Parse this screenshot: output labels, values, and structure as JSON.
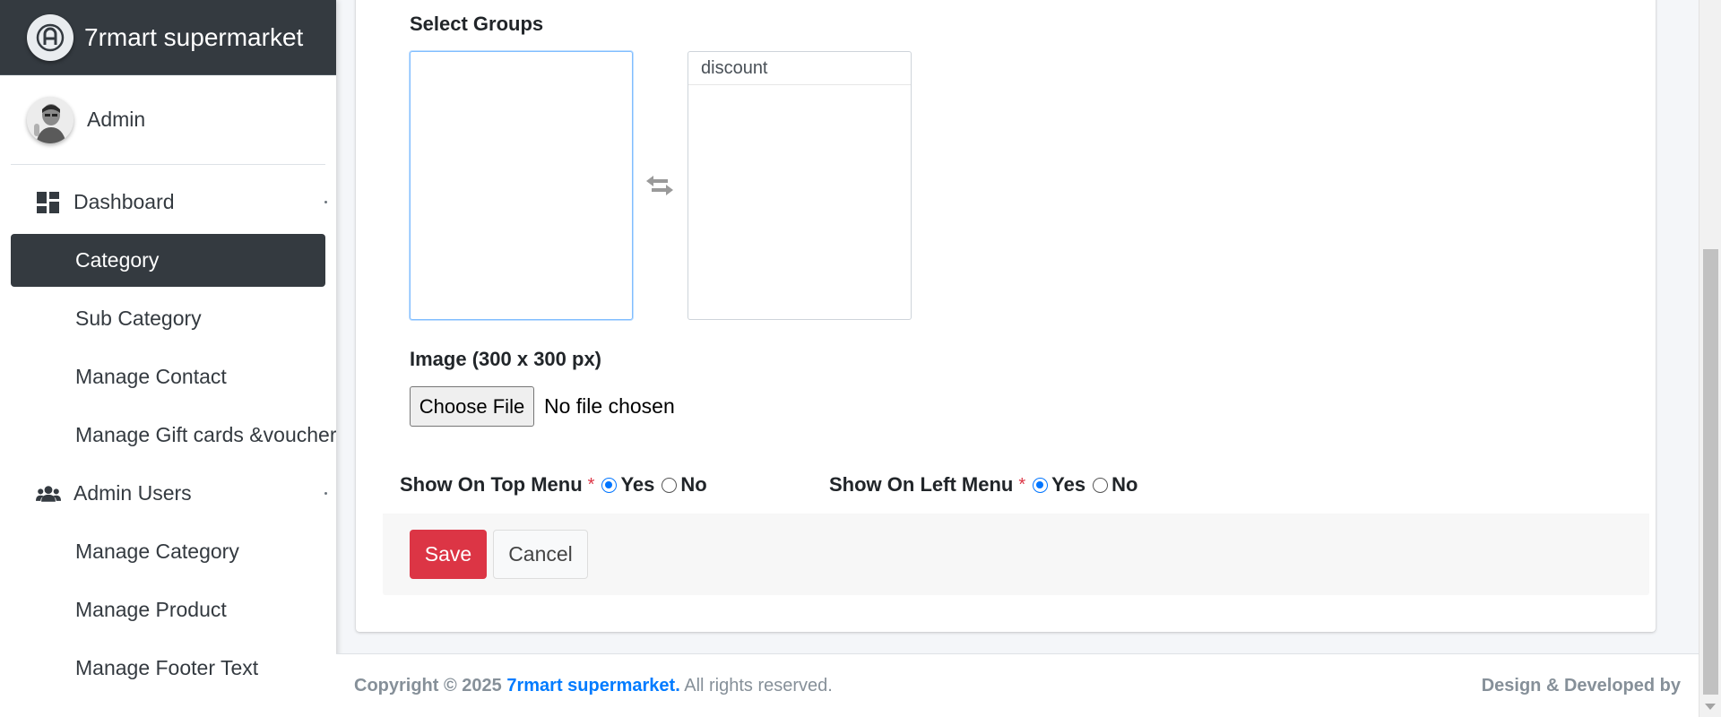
{
  "brand": {
    "name": "7rmart supermarket",
    "logo_icon": "brand-logo-icon"
  },
  "user": {
    "name": "Admin"
  },
  "sidebar": {
    "items": [
      {
        "label": "Dashboard",
        "icon": "dashboard-icon",
        "type": "parent"
      },
      {
        "label": "Category",
        "type": "sub",
        "active": true
      },
      {
        "label": "Sub Category",
        "type": "sub"
      },
      {
        "label": "Manage Contact",
        "type": "sub"
      },
      {
        "label": "Manage Gift cards &voucher",
        "type": "sub"
      },
      {
        "label": "Admin Users",
        "icon": "users-icon",
        "type": "parent"
      },
      {
        "label": "Manage Category",
        "type": "sub"
      },
      {
        "label": "Manage Product",
        "type": "sub"
      },
      {
        "label": "Manage Footer Text",
        "type": "sub"
      }
    ]
  },
  "form": {
    "select_groups_label": "Select Groups",
    "available_groups": [],
    "selected_groups": [
      "discount"
    ],
    "image_label": "Image (300 x 300 px)",
    "file_button": "Choose File",
    "file_status": "No file chosen",
    "top_menu": {
      "label": "Show On Top Menu",
      "required": "*",
      "yes": "Yes",
      "no": "No",
      "selected": "Yes"
    },
    "left_menu": {
      "label": "Show On Left Menu",
      "required": "*",
      "yes": "Yes",
      "no": "No",
      "selected": "Yes"
    },
    "save_label": "Save",
    "cancel_label": "Cancel"
  },
  "footer": {
    "copyright": "Copyright © 2025",
    "brand_link": "7rmart supermarket.",
    "rights": "All rights reserved.",
    "credit": "Design & Developed by"
  },
  "colors": {
    "brand_bar": "#343a40",
    "active_nav": "#343a40",
    "save_button": "#dc3545",
    "link": "#007bff",
    "required": "#dc3545",
    "radio_checked": "#0075ff"
  }
}
